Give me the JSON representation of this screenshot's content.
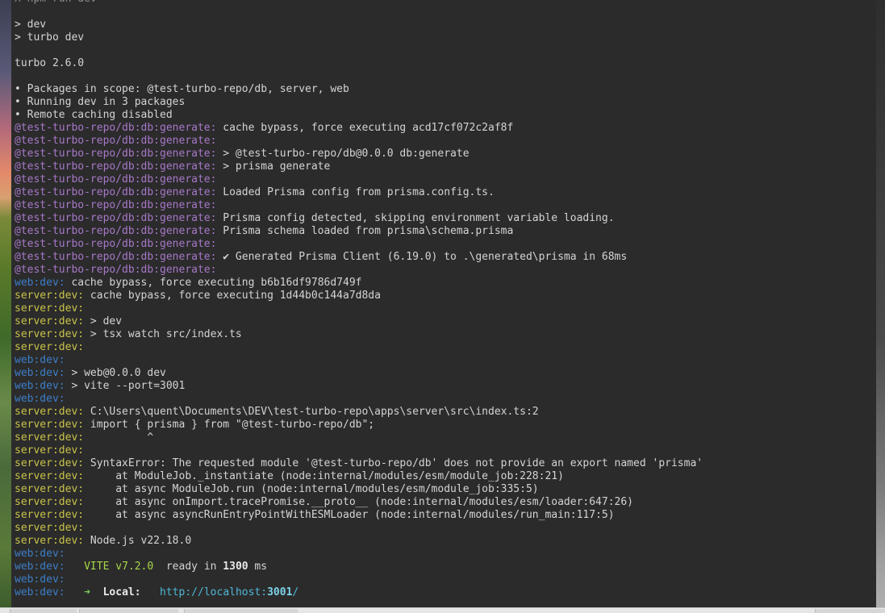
{
  "terminal": {
    "lines": [
      [
        {
          "t": "λ npm run dev",
          "c": "c-dim"
        }
      ],
      [],
      [
        {
          "t": "> dev"
        }
      ],
      [
        {
          "t": "> turbo dev"
        }
      ],
      [],
      [
        {
          "t": "turbo 2.6.0"
        }
      ],
      [],
      [
        {
          "t": "• Packages in scope: @test-turbo-repo/db, server, web"
        }
      ],
      [
        {
          "t": "• Running dev in 3 packages"
        }
      ],
      [
        {
          "t": "• Remote caching disabled"
        }
      ],
      [
        {
          "t": "@test-turbo-repo/db:db:generate:",
          "c": "c-db"
        },
        {
          "t": " cache bypass, force executing acd17cf072c2af8f"
        }
      ],
      [
        {
          "t": "@test-turbo-repo/db:db:generate:",
          "c": "c-db"
        }
      ],
      [
        {
          "t": "@test-turbo-repo/db:db:generate:",
          "c": "c-db"
        },
        {
          "t": " > @test-turbo-repo/db@0.0.0 db:generate"
        }
      ],
      [
        {
          "t": "@test-turbo-repo/db:db:generate:",
          "c": "c-db"
        },
        {
          "t": " > prisma generate"
        }
      ],
      [
        {
          "t": "@test-turbo-repo/db:db:generate:",
          "c": "c-db"
        }
      ],
      [
        {
          "t": "@test-turbo-repo/db:db:generate:",
          "c": "c-db"
        },
        {
          "t": " Loaded Prisma config from prisma.config.ts."
        }
      ],
      [
        {
          "t": "@test-turbo-repo/db:db:generate:",
          "c": "c-db"
        }
      ],
      [
        {
          "t": "@test-turbo-repo/db:db:generate:",
          "c": "c-db"
        },
        {
          "t": " Prisma config detected, skipping environment variable loading."
        }
      ],
      [
        {
          "t": "@test-turbo-repo/db:db:generate:",
          "c": "c-db"
        },
        {
          "t": " Prisma schema loaded from prisma\\schema.prisma"
        }
      ],
      [
        {
          "t": "@test-turbo-repo/db:db:generate:",
          "c": "c-db"
        }
      ],
      [
        {
          "t": "@test-turbo-repo/db:db:generate:",
          "c": "c-db"
        },
        {
          "t": " ✔ Generated Prisma Client (6.19.0) to .\\generated\\prisma in 68ms"
        }
      ],
      [
        {
          "t": "@test-turbo-repo/db:db:generate:",
          "c": "c-db"
        }
      ],
      [
        {
          "t": "web:dev:",
          "c": "c-web"
        },
        {
          "t": " cache bypass, force executing b6b16df9786d749f"
        }
      ],
      [
        {
          "t": "server:dev:",
          "c": "c-server"
        },
        {
          "t": " cache bypass, force executing 1d44b0c144a7d8da"
        }
      ],
      [
        {
          "t": "server:dev:",
          "c": "c-server"
        }
      ],
      [
        {
          "t": "server:dev:",
          "c": "c-server"
        },
        {
          "t": " > dev"
        }
      ],
      [
        {
          "t": "server:dev:",
          "c": "c-server"
        },
        {
          "t": " > tsx watch src/index.ts"
        }
      ],
      [
        {
          "t": "server:dev:",
          "c": "c-server"
        }
      ],
      [
        {
          "t": "web:dev:",
          "c": "c-web"
        }
      ],
      [
        {
          "t": "web:dev:",
          "c": "c-web"
        },
        {
          "t": " > web@0.0.0 dev"
        }
      ],
      [
        {
          "t": "web:dev:",
          "c": "c-web"
        },
        {
          "t": " > vite --port=3001"
        }
      ],
      [
        {
          "t": "web:dev:",
          "c": "c-web"
        }
      ],
      [
        {
          "t": "server:dev:",
          "c": "c-server"
        },
        {
          "t": " C:\\Users\\quent\\Documents\\DEV\\test-turbo-repo\\apps\\server\\src\\index.ts:2"
        }
      ],
      [
        {
          "t": "server:dev:",
          "c": "c-server"
        },
        {
          "t": " import { prisma } from \"@test-turbo-repo/db\";"
        }
      ],
      [
        {
          "t": "server:dev:",
          "c": "c-server"
        },
        {
          "t": "          ^"
        }
      ],
      [
        {
          "t": "server:dev:",
          "c": "c-server"
        }
      ],
      [
        {
          "t": "server:dev:",
          "c": "c-server"
        },
        {
          "t": " SyntaxError: The requested module '@test-turbo-repo/db' does not provide an export named 'prisma'"
        }
      ],
      [
        {
          "t": "server:dev:",
          "c": "c-server"
        },
        {
          "t": "     at ModuleJob._instantiate (node:internal/modules/esm/module_job:228:21)"
        }
      ],
      [
        {
          "t": "server:dev:",
          "c": "c-server"
        },
        {
          "t": "     at async ModuleJob.run (node:internal/modules/esm/module_job:335:5)"
        }
      ],
      [
        {
          "t": "server:dev:",
          "c": "c-server"
        },
        {
          "t": "     at async onImport.tracePromise.__proto__ (node:internal/modules/esm/loader:647:26)"
        }
      ],
      [
        {
          "t": "server:dev:",
          "c": "c-server"
        },
        {
          "t": "     at async asyncRunEntryPointWithESMLoader (node:internal/modules/run_main:117:5)"
        }
      ],
      [
        {
          "t": "server:dev:",
          "c": "c-server"
        }
      ],
      [
        {
          "t": "server:dev:",
          "c": "c-server"
        },
        {
          "t": " Node.js v22.18.0"
        }
      ],
      [
        {
          "t": "web:dev:",
          "c": "c-web"
        }
      ],
      [
        {
          "t": "web:dev:",
          "c": "c-web"
        },
        {
          "t": "   "
        },
        {
          "t": "VITE v7.2.0",
          "c": "c-vite"
        },
        {
          "t": "  ready in "
        },
        {
          "t": "1300",
          "c": "c-bright b"
        },
        {
          "t": " ms"
        }
      ],
      [
        {
          "t": "web:dev:",
          "c": "c-web"
        }
      ],
      [
        {
          "t": "web:dev:",
          "c": "c-web"
        },
        {
          "t": "   "
        },
        {
          "t": "➜",
          "c": "c-green"
        },
        {
          "t": "  "
        },
        {
          "t": "Local:",
          "c": "c-bright b"
        },
        {
          "t": "   "
        },
        {
          "t": "http://localhost:",
          "c": "c-link"
        },
        {
          "t": "3001",
          "c": "c-port b"
        },
        {
          "t": "/",
          "c": "c-link"
        }
      ]
    ]
  },
  "colors": {
    "background": "#2b2b2b",
    "db_prefix": "#a778c8",
    "web_prefix": "#3d7ec8",
    "server_prefix": "#c9c34a",
    "vite_green": "#a8d84a",
    "link_cyan": "#4fb7d9"
  }
}
